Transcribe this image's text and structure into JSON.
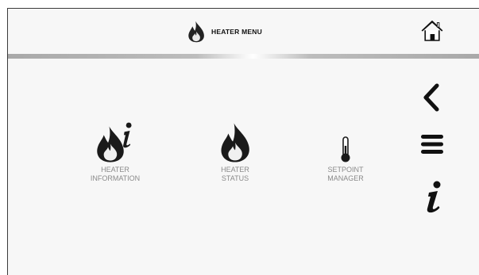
{
  "header": {
    "title": "HEATER MENU",
    "title_icon": "flame-icon",
    "home_icon": "home-icon"
  },
  "menu": {
    "items": [
      {
        "label": "HEATER\nINFORMATION",
        "icon": "flame-info-icon"
      },
      {
        "label": "HEATER\nSTATUS",
        "icon": "flame-icon"
      },
      {
        "label": "SETPOINT\nMANAGER",
        "icon": "thermometer-icon"
      }
    ]
  },
  "side_nav": {
    "back_icon": "chevron-left-icon",
    "menu_icon": "hamburger-menu-icon",
    "info_icon": "info-icon"
  },
  "colors": {
    "background": "#f7f7f7",
    "label_gray": "#8a8a8a",
    "icon_dark": "#1a1a1a"
  }
}
